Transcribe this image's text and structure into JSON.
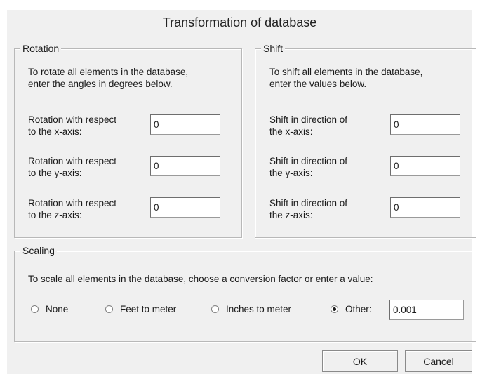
{
  "dialog": {
    "title": "Transformation of database"
  },
  "rotation": {
    "legend": "Rotation",
    "intro": [
      "To rotate all elements in the database,",
      "enter the angles in degrees below."
    ],
    "rows": [
      {
        "label": [
          "Rotation with respect",
          "to the x-axis:"
        ],
        "value": "0"
      },
      {
        "label": [
          "Rotation with respect",
          "to the y-axis:"
        ],
        "value": "0"
      },
      {
        "label": [
          "Rotation with respect",
          "to the z-axis:"
        ],
        "value": "0"
      }
    ]
  },
  "shift": {
    "legend": "Shift",
    "intro": [
      "To shift all elements in the database,",
      "enter the values below."
    ],
    "rows": [
      {
        "label": [
          "Shift in direction of",
          "the x-axis:"
        ],
        "value": "0"
      },
      {
        "label": [
          "Shift in direction of",
          "the y-axis:"
        ],
        "value": "0"
      },
      {
        "label": [
          "Shift in direction of",
          "the z-axis:"
        ],
        "value": "0"
      }
    ]
  },
  "scaling": {
    "legend": "Scaling",
    "intro": "To scale all elements in the database, choose a conversion factor or enter a value:",
    "options": [
      {
        "label": "None",
        "checked": false
      },
      {
        "label": "Feet to meter",
        "checked": false
      },
      {
        "label": "Inches to meter",
        "checked": false
      },
      {
        "label": "Other:",
        "checked": true
      }
    ],
    "other_value": "0.001"
  },
  "buttons": {
    "ok": "OK",
    "cancel": "Cancel"
  }
}
